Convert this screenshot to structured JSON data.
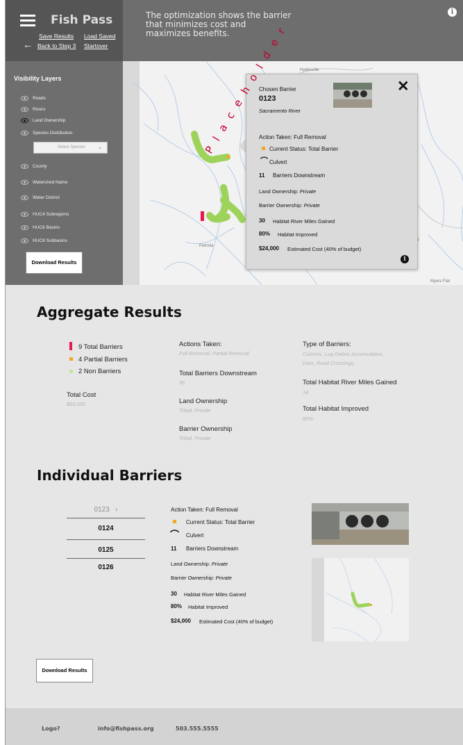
{
  "header": {
    "app_title": "Fish Pass",
    "save_results": "Save Results",
    "load_saved": "Load Saved",
    "back_to_step": "Back to Step 3",
    "startover": "Startover",
    "description": "The optimization shows the barrier that minimizes cost and maximizes benefits."
  },
  "sidebar": {
    "title": "Visibility Layers",
    "layers": [
      "Roads",
      "Rivers",
      "Land Ownership",
      "Species Distribution",
      "County",
      "Watershed Name",
      "Water District",
      "HUC4 Subregions",
      "HUC6 Basins",
      "HUC8 Subbasins"
    ],
    "select_placeholder": "Select Species",
    "download": "Download Results"
  },
  "map": {
    "labels": [
      "Hydesville",
      "Petrolia",
      "Myers Flat",
      "rt"
    ]
  },
  "popup": {
    "chosen_barrier_label": "Chosen Barrier",
    "barrier_id": "0123",
    "river": "Sacramento River",
    "action_taken": "Action Taken: Full Removal",
    "current_status": "Current Status: Total Barrier",
    "culvert": "Culvert",
    "downstream_count": "11",
    "downstream_label": "Barriers Downstream",
    "land_ownership_label": "Land Ownership:",
    "land_ownership_value": "Private",
    "barrier_ownership_label": "Barrier Ownership:",
    "barrier_ownership_value": "Private",
    "miles_gained_value": "30",
    "miles_gained_label": "Habitat River Miles Gained",
    "habitat_improved_value": "80%",
    "habitat_improved_label": "Habitat Improved",
    "cost_value": "$24,000",
    "cost_label": "Estimated Cost (40% of budget)",
    "placeholder_overlay": "Placeholder"
  },
  "aggregate": {
    "title": "Aggregate Results",
    "total_barriers": "9 Total Barriers",
    "partial_barriers": "4 Partial Barriers",
    "non_barriers": "2 Non Barriers",
    "total_cost_label": "Total Cost",
    "total_cost_value": "$60,000",
    "actions_label": "Actions Taken:",
    "actions_value": "Full Removal, Partial Removal",
    "downstream_label": "Total Barriers Downstream",
    "downstream_value": "55",
    "land_label": "Land Ownership",
    "land_value": "Tribal, Private",
    "barrier_own_label": "Barrier Ownership",
    "barrier_own_value": "Tribal, Private",
    "types_label": "Type of Barriers:",
    "types_value_1": "Culverts, Log Debris Accumulation,",
    "types_value_2": "Dam, Road Crossings,",
    "miles_label": "Total Habitat River Miles Gained",
    "miles_value": "14",
    "improved_label": "Total Habitat Improved",
    "improved_value": "80%"
  },
  "individual": {
    "title": "Individual Barriers",
    "barrier_ids": [
      "0123",
      "0124",
      "0125",
      "0126"
    ],
    "selected_chevron": "›",
    "action_taken": "Action Taken: Full Removal",
    "current_status": "Current Status: Total Barrier",
    "culvert": "Culvert",
    "downstream_count": "11",
    "downstream_label": "Barriers Downstream",
    "land_ownership_label": "Land Ownership:",
    "land_ownership_value": "Private",
    "barrier_ownership_label": "Barrier Ownership:",
    "barrier_ownership_value": "Private",
    "miles_gained_value": "30",
    "miles_gained_label": "Habitat River Miles Gained",
    "habitat_improved_value": "80%",
    "habitat_improved_label": "Habitat Improved",
    "cost_value": "$24,000",
    "cost_label": "Estimated Cost (40% of budget)",
    "download": "Download Results"
  },
  "footer": {
    "logo": "Logo?",
    "email": "info@fishpass.org",
    "phone": "503.555.5555"
  },
  "colors": {
    "total_barrier": "#e8184f",
    "partial_barrier": "#f5a623",
    "non_barrier": "#b8e986",
    "stream": "#9dd35b"
  },
  "icons": [
    "menu-icon",
    "back-arrow-icon",
    "info-icon",
    "eye-icon",
    "close-icon",
    "culvert-icon",
    "chevron-down-icon",
    "chevron-right-icon"
  ]
}
